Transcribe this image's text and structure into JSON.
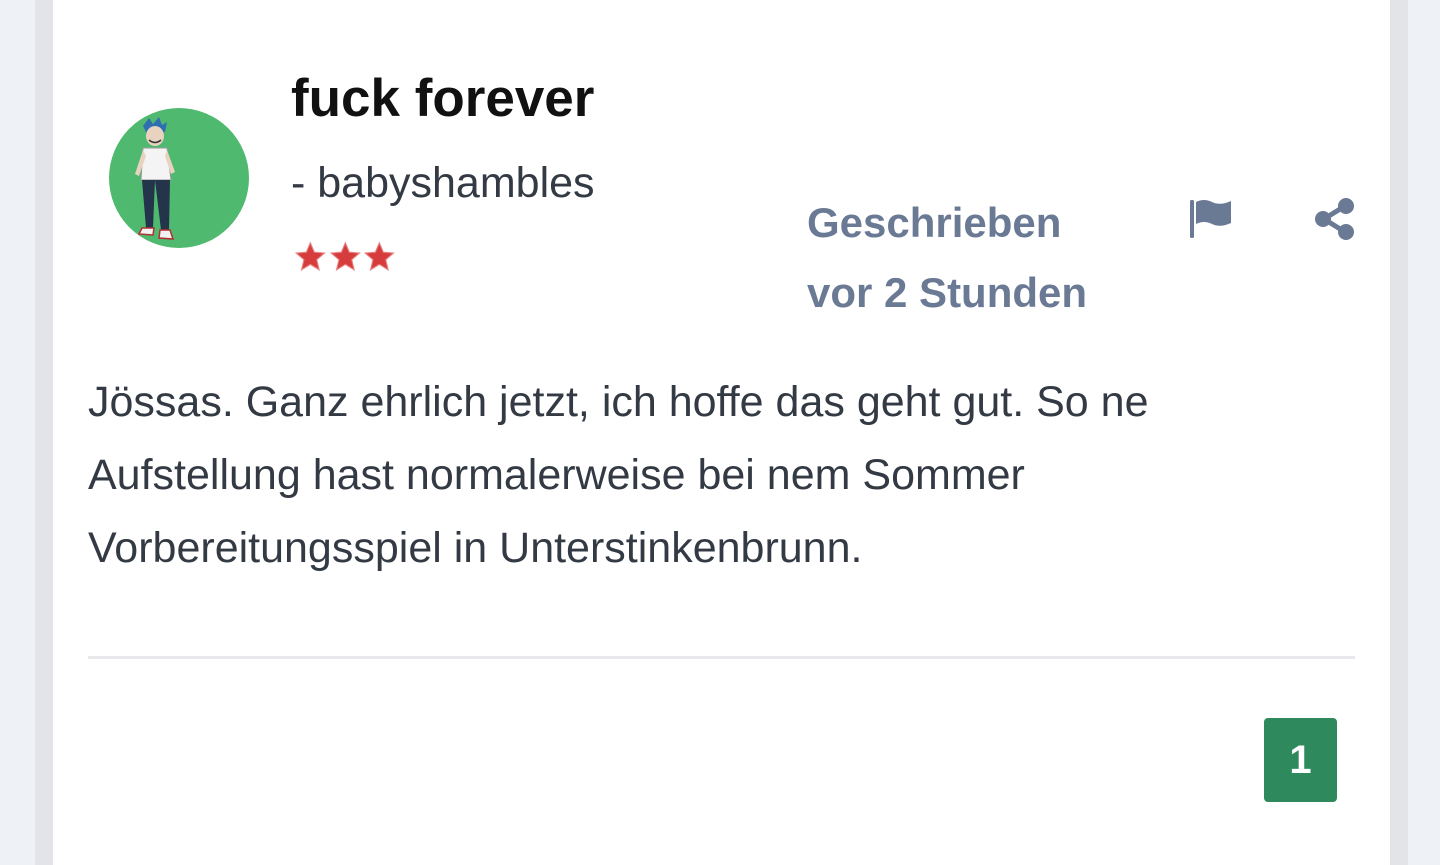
{
  "post": {
    "title": "fuck forever",
    "author": "- babyshambles",
    "rating_stars": 3,
    "rating_max": 3,
    "meta_line1": "Geschrieben",
    "meta_line2": "vor 2 Stunden",
    "body": "Jössas. Ganz ehrlich jetzt, ich hoffe das geht gut. So ne Aufstellung hast normalerweise bei nem Sommer Vorbereitungsspiel in Unterstinkenbrunn.",
    "avatar_bg": "#4fba6f",
    "star_color": "#d63c3c"
  },
  "actions": {
    "flag_icon": "flag-icon",
    "share_icon": "share-icon",
    "icon_color": "#6b7a94"
  },
  "pagination": {
    "current_page": "1",
    "badge_color": "#2e8a5c"
  }
}
